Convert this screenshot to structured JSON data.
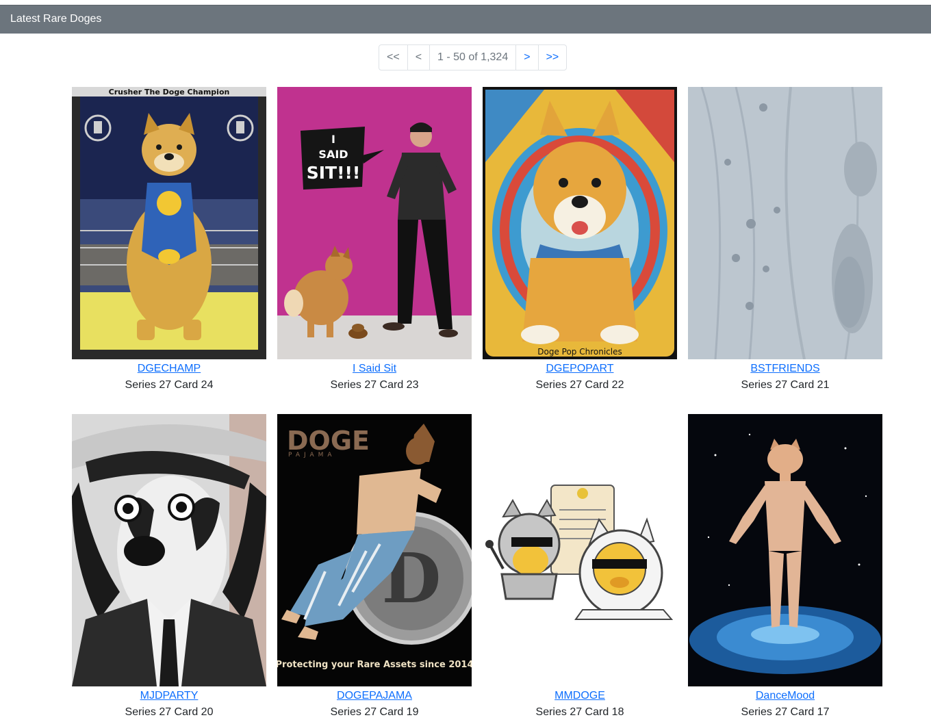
{
  "header": {
    "title": "Latest Rare Doges"
  },
  "pagination": {
    "first": "<<",
    "prev": "<",
    "info": "1 - 50 of 1,324",
    "next": ">",
    "last": ">>"
  },
  "cards": [
    {
      "name": "DGECHAMP",
      "series": "Series 27 Card 24",
      "image_text": "Crusher The Doge Champion"
    },
    {
      "name": "I Said Sit",
      "series": "Series 27 Card 23",
      "image_text": [
        "I",
        "SAID",
        "SIT!!!"
      ]
    },
    {
      "name": "DGEPOPART",
      "series": "Series 27 Card 22",
      "image_text": "Doge Pop Chronicles"
    },
    {
      "name": "BSTFRIENDS",
      "series": "Series 27 Card 21"
    },
    {
      "name": "MJDPARTY",
      "series": "Series 27 Card 20"
    },
    {
      "name": "DOGEPAJAMA",
      "series": "Series 27 Card 19",
      "image_text": [
        "DOGE",
        "PAJAMA",
        "D",
        "Protecting your Rare Assets since 2014"
      ]
    },
    {
      "name": "MMDOGE",
      "series": "Series 27 Card 18"
    },
    {
      "name": "DanceMood",
      "series": "Series 27 Card 17"
    }
  ],
  "colors": {
    "header_bg": "#6c757d",
    "link": "#0d6efd",
    "text": "#212529",
    "pager_border": "#dee2e6"
  }
}
